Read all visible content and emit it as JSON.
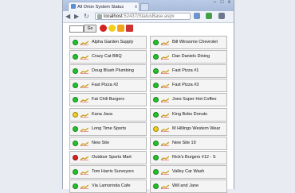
{
  "browser": {
    "tab_title": "All Orion System Status",
    "tab_close": "x",
    "window_buttons": "– □ x",
    "url_host": "localhost",
    "url_path": ":52437/StatusBase.aspx"
  },
  "page": {
    "search_value": "",
    "go_label": "Go",
    "colors": {
      "green": "#22c32a",
      "yellow": "#f2cf1a",
      "red": "#d62020"
    },
    "sites": [
      {
        "name": "Alpha Garden Supply",
        "status": "green"
      },
      {
        "name": "Bill Winsome Chevrolet",
        "status": "green"
      },
      {
        "name": "Crazy Cat BBQ",
        "status": "green"
      },
      {
        "name": "Dan Daniels Dining",
        "status": "green"
      },
      {
        "name": "Doug Blush Plumbing",
        "status": "green"
      },
      {
        "name": "Fast Pizza #1",
        "status": "green"
      },
      {
        "name": "Fast Pizza #2",
        "status": "green"
      },
      {
        "name": "Fast Pizza #3",
        "status": "green"
      },
      {
        "name": "Fat Chili Burgers",
        "status": "green"
      },
      {
        "name": "Joes Super Hot Coffee",
        "status": "green"
      },
      {
        "name": "Kana Java",
        "status": "yellow"
      },
      {
        "name": "King Bobs Donuts",
        "status": "green"
      },
      {
        "name": "Long Time Sports",
        "status": "green"
      },
      {
        "name": "M Hillings Western Wear",
        "status": "yellow"
      },
      {
        "name": "New Site",
        "status": "green"
      },
      {
        "name": "New Site 19",
        "status": "green"
      },
      {
        "name": "Outdoor Sports Mart",
        "status": "red"
      },
      {
        "name": "Rick's Burgers #12 - S",
        "status": "green"
      },
      {
        "name": "Tom Harris Surveyors",
        "status": "green"
      },
      {
        "name": "Valley Car Wash",
        "status": "green"
      },
      {
        "name": "Via Lamorinda Cafe",
        "status": "green"
      },
      {
        "name": "Will and Jane",
        "status": "green"
      }
    ]
  }
}
